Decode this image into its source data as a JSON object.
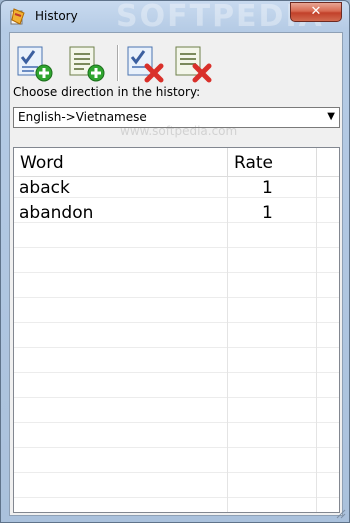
{
  "window": {
    "title": "History",
    "watermark": "SOFTPEDIA",
    "close_label": "✕"
  },
  "toolbar": {
    "buttons": [
      {
        "name": "add-selected-button",
        "icon": "check-list-add-icon"
      },
      {
        "name": "add-all-button",
        "icon": "list-add-icon"
      },
      {
        "name": "delete-selected-button",
        "icon": "check-list-delete-icon"
      },
      {
        "name": "delete-all-button",
        "icon": "list-delete-icon"
      }
    ]
  },
  "direction": {
    "label": "Choose direction in the history:",
    "selected": "English->Vietnamese",
    "watermark": "www.softpedia.com"
  },
  "table": {
    "columns": [
      "Word",
      "Rate"
    ],
    "rows": [
      {
        "word": "aback",
        "rate": "1"
      },
      {
        "word": "abandon",
        "rate": "1"
      }
    ]
  },
  "colors": {
    "add": "#2fa52f",
    "delete": "#d9302a",
    "frame": "#aac1dc"
  }
}
